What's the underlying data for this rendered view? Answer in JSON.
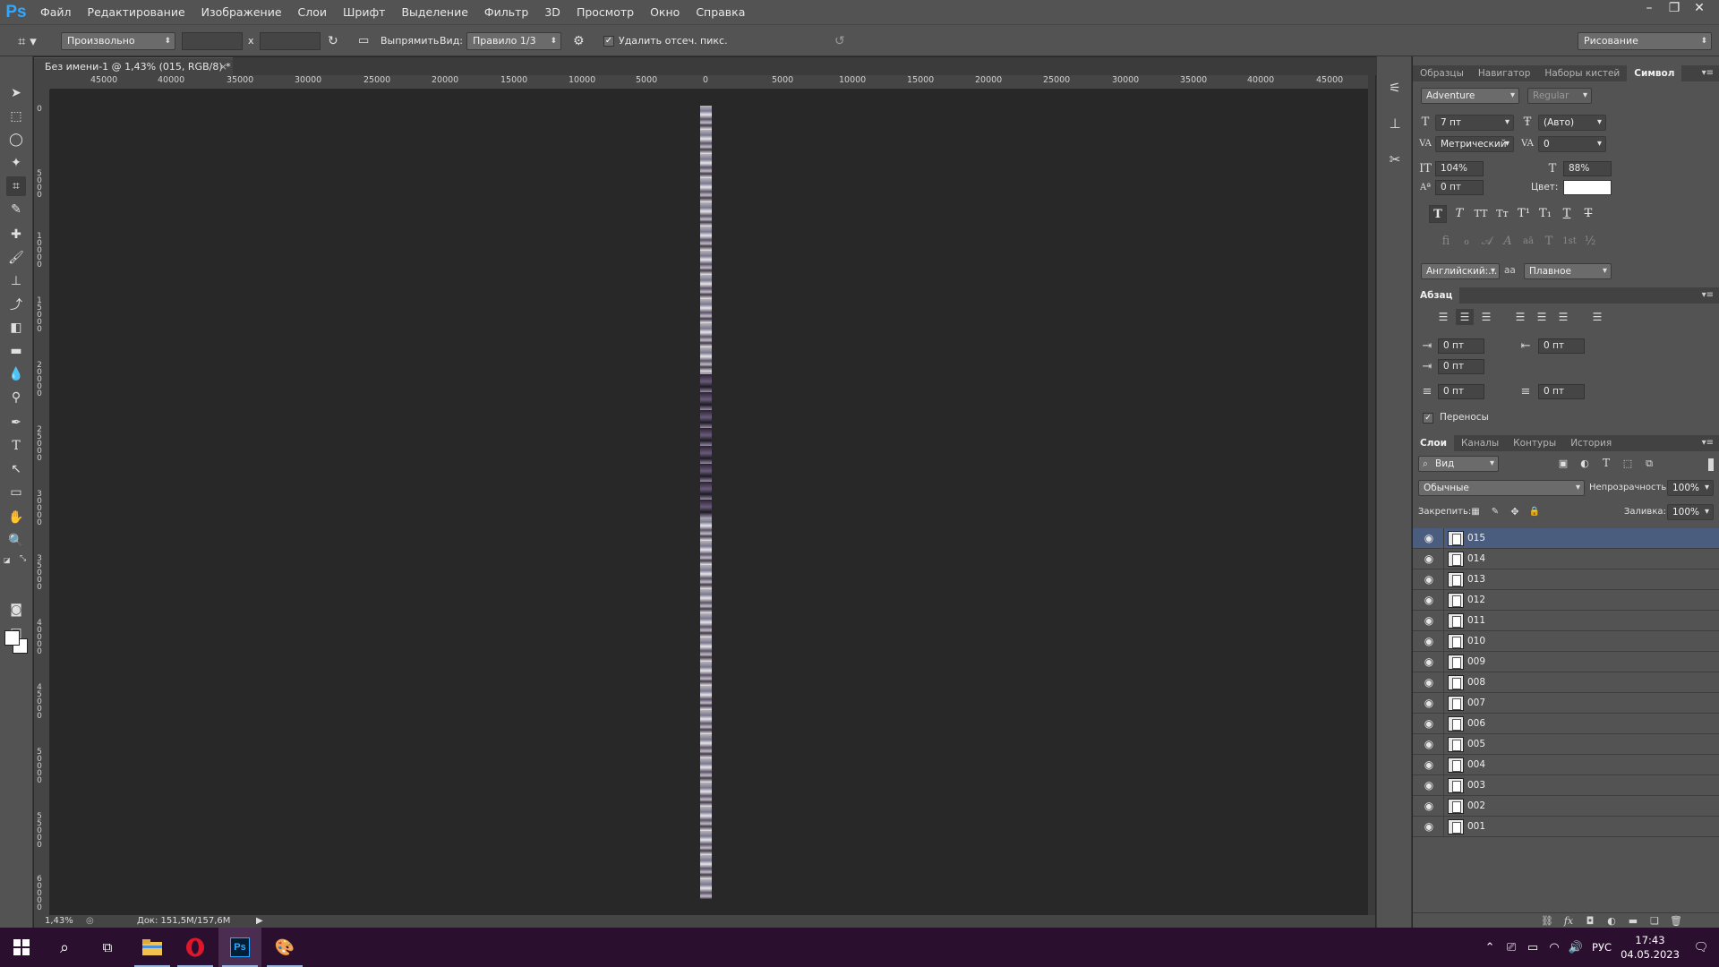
{
  "app": {
    "logo": "Ps",
    "menu": [
      "Файл",
      "Редактирование",
      "Изображение",
      "Слои",
      "Шрифт",
      "Выделение",
      "Фильтр",
      "3D",
      "Просмотр",
      "Окно",
      "Справка"
    ]
  },
  "options": {
    "ratio_preset": "Произвольно",
    "x_separator": "x",
    "straighten_label": "Выпрямить",
    "view_label": "Вид:",
    "view_value": "Правило 1/3",
    "delete_cropped_label": "Удалить отсеч. пикс.",
    "delete_cropped_checked": true,
    "workspace": "Рисование"
  },
  "document": {
    "tab_title": "Без имени-1 @ 1,43% (015, RGB/8) *",
    "ruler_labels": [
      "45000",
      "40000",
      "35000",
      "30000",
      "25000",
      "20000",
      "15000",
      "10000",
      "5000",
      "0",
      "5000",
      "10000",
      "15000",
      "20000",
      "25000",
      "30000",
      "35000",
      "40000",
      "45000"
    ],
    "vruler_labels": [
      "0",
      "5000",
      "10000",
      "15000",
      "20000",
      "25000",
      "30000",
      "35000",
      "40000",
      "45000",
      "50000",
      "55000",
      "60000"
    ],
    "zoom": "1,43%",
    "doc_size": "Док: 151,5M/157,6M"
  },
  "character_panel": {
    "tabs": [
      "Образцы",
      "Навигатор",
      "Наборы кистей",
      "Символ"
    ],
    "active_tab": "Символ",
    "font_family": "Adventure",
    "font_style": "Regular",
    "font_size": "7 пт",
    "leading": "(Авто)",
    "kerning": "Метрический",
    "tracking": "0",
    "vertical_scale": "104%",
    "horizontal_scale": "88%",
    "baseline_shift": "0 пт",
    "color_label": "Цвет:",
    "text_color": "#ffffff",
    "language": "Английский:...",
    "aa_label": "aa",
    "antialias": "Плавное"
  },
  "paragraph_panel": {
    "title": "Абзац",
    "indent_left": "0 пт",
    "indent_right": "0 пт",
    "indent_first": "0 пт",
    "space_before": "0 пт",
    "space_after": "0 пт",
    "hyphenation_label": "Переносы",
    "hyphenation_checked": true
  },
  "layers_panel": {
    "tabs": [
      "Слои",
      "Каналы",
      "Контуры",
      "История"
    ],
    "active_tab": "Слои",
    "filter_kind": "Вид",
    "blend_mode": "Обычные",
    "opacity_label": "Непрозрачность:",
    "opacity": "100%",
    "lock_label": "Закрепить:",
    "fill_label": "Заливка:",
    "fill": "100%",
    "layers": [
      "015",
      "014",
      "013",
      "012",
      "011",
      "010",
      "009",
      "008",
      "007",
      "006",
      "005",
      "004",
      "003",
      "002",
      "001"
    ],
    "selected_layer": "015"
  },
  "taskbar": {
    "language": "РУС",
    "time": "17:43",
    "date": "04.05.2023",
    "ps_label": "Ps"
  }
}
